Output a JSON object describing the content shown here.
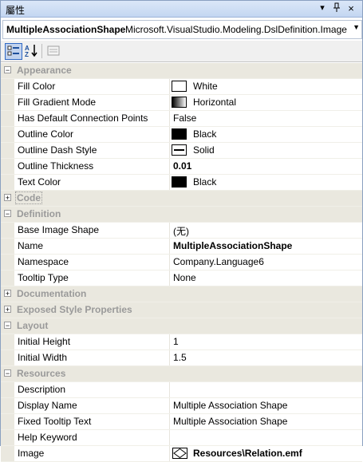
{
  "window": {
    "title": "屬性"
  },
  "titlebar_buttons": {
    "dropdown": "▾",
    "pin": "‡",
    "close": "×"
  },
  "selector": {
    "object_name": "MultipleAssociationShape",
    "object_type": "Microsoft.VisualStudio.Modeling.DslDefinition.Image",
    "arrow": "▼"
  },
  "toolbar": {
    "icons": [
      "categorized-icon",
      "alphabetical-icon",
      "property-pages-icon"
    ]
  },
  "categories": {
    "appearance": {
      "label": "Appearance",
      "expanded": true
    },
    "code": {
      "label": "Code",
      "expanded": false
    },
    "definition": {
      "label": "Definition",
      "expanded": true
    },
    "documentation": {
      "label": "Documentation",
      "expanded": false
    },
    "exposed": {
      "label": "Exposed Style Properties",
      "expanded": false
    },
    "layout": {
      "label": "Layout",
      "expanded": true
    },
    "resources": {
      "label": "Resources",
      "expanded": true
    }
  },
  "props": {
    "fill_color": {
      "name": "Fill Color",
      "value": "White",
      "swatch": "#ffffff"
    },
    "fill_gradient": {
      "name": "Fill Gradient Mode",
      "value": "Horizontal"
    },
    "has_default_cp": {
      "name": "Has Default Connection Points",
      "value": "False"
    },
    "outline_color": {
      "name": "Outline Color",
      "value": "Black",
      "swatch": "#000000"
    },
    "outline_dash": {
      "name": "Outline Dash Style",
      "value": "Solid"
    },
    "outline_thickness": {
      "name": "Outline Thickness",
      "value": "0.01"
    },
    "text_color": {
      "name": "Text Color",
      "value": "Black",
      "swatch": "#000000"
    },
    "base_image_shape": {
      "name": "Base Image Shape",
      "value": "(无)"
    },
    "name": {
      "name": "Name",
      "value": "MultipleAssociationShape"
    },
    "namespace": {
      "name": "Namespace",
      "value": "Company.Language6"
    },
    "tooltip_type": {
      "name": "Tooltip Type",
      "value": "None"
    },
    "initial_height": {
      "name": "Initial Height",
      "value": "1"
    },
    "initial_width": {
      "name": "Initial Width",
      "value": "1.5"
    },
    "description": {
      "name": "Description",
      "value": ""
    },
    "display_name": {
      "name": "Display Name",
      "value": "Multiple Association Shape"
    },
    "fixed_tooltip": {
      "name": "Fixed Tooltip Text",
      "value": "Multiple Association Shape"
    },
    "help_keyword": {
      "name": "Help Keyword",
      "value": ""
    },
    "image": {
      "name": "Image",
      "value": "Resources\\Relation.emf"
    }
  },
  "glyphs": {
    "expanded": "−",
    "collapsed": "+"
  }
}
